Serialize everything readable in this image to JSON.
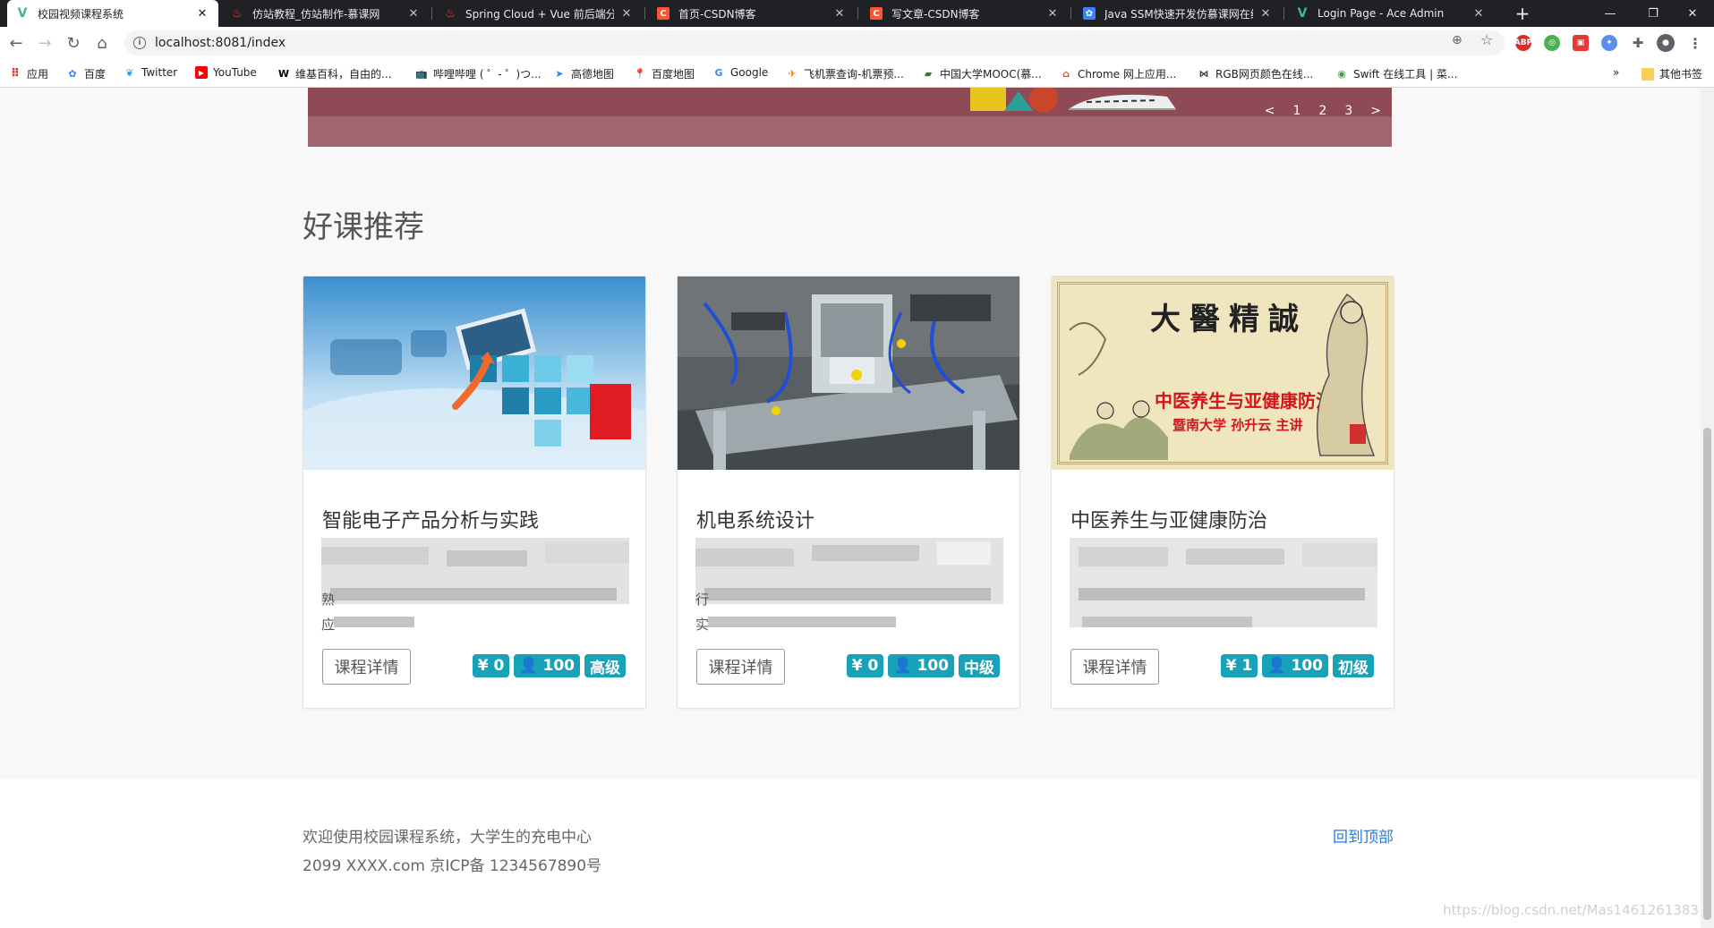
{
  "browser": {
    "tabs": [
      {
        "title": "校园视频课程系统",
        "favicon": "vue-logo-icon",
        "color": "#41b883",
        "active": true
      },
      {
        "title": "仿站教程_仿站制作-慕课网",
        "favicon": "flame-icon",
        "color": "#e8453c"
      },
      {
        "title": "Spring Cloud + Vue 前后端分离",
        "favicon": "flame-icon",
        "color": "#e8453c"
      },
      {
        "title": "首页-CSDN博客",
        "favicon": "csdn-icon",
        "color": "#fc5531"
      },
      {
        "title": "写文章-CSDN博客",
        "favicon": "csdn-icon",
        "color": "#fc5531"
      },
      {
        "title": "Java SSM快速开发仿慕课网在线",
        "favicon": "paw-icon",
        "color": "#3385ff"
      },
      {
        "title": "Login Page - Ace Admin",
        "favicon": "vue-logo-icon",
        "color": "#41b883"
      }
    ],
    "url": "localhost:8081/index",
    "bookmarks": [
      {
        "label": "应用",
        "icon": "apps-grid-icon"
      },
      {
        "label": "百度",
        "icon": "baidu-paw-icon"
      },
      {
        "label": "Twitter",
        "icon": "twitter-bird-icon"
      },
      {
        "label": "YouTube",
        "icon": "youtube-icon"
      },
      {
        "label": "维基百科，自由的...",
        "icon": "wikipedia-w-icon"
      },
      {
        "label": "哔哩哔哩 ( ゜- ゜)つ...",
        "icon": "bilibili-tv-icon"
      },
      {
        "label": "高德地图",
        "icon": "amap-icon"
      },
      {
        "label": "百度地图",
        "icon": "map-pin-icon"
      },
      {
        "label": "Google",
        "icon": "google-g-icon"
      },
      {
        "label": "飞机票查询-机票预...",
        "icon": "flight-icon"
      },
      {
        "label": "中国大学MOOC(慕...",
        "icon": "mooc-icon"
      },
      {
        "label": "Chrome 网上应用...",
        "icon": "chrome-store-icon"
      },
      {
        "label": "RGB网页颜色在线...",
        "icon": "rgb-icon"
      },
      {
        "label": "Swift 在线工具 | 菜...",
        "icon": "swift-icon"
      }
    ],
    "other_bookmarks": "其他书签",
    "overflow": "»"
  },
  "banner": {
    "pager": [
      "<",
      "1",
      "2",
      "3",
      ">"
    ]
  },
  "section": {
    "title": "好课推荐"
  },
  "courses": [
    {
      "title": "智能电子产品分析与实践",
      "detail_label": "课程详情",
      "price": "¥ 0",
      "enrolled": "100",
      "level": "高级",
      "snippet": [
        "熟",
        "应"
      ]
    },
    {
      "title": "机电系统设计",
      "detail_label": "课程详情",
      "price": "¥ 0",
      "enrolled": "100",
      "level": "中级",
      "snippet": [
        "行",
        "实"
      ]
    },
    {
      "title": "中医养生与亚健康防治",
      "detail_label": "课程详情",
      "price": "¥ 1",
      "enrolled": "100",
      "level": "初级",
      "image_text": {
        "heading": "大醫精誠",
        "subtitle": "中医养生与亚健康防治",
        "lecturer": "暨南大学  孙升云 主讲"
      }
    }
  ],
  "footer": {
    "welcome": "欢迎使用校园课程系统，大学生的充电中心",
    "copyright": "2099 XXXX.com 京ICP备 1234567890号",
    "back_to_top": "回到顶部"
  },
  "watermark": "https://blog.csdn.net/Mas1461261383",
  "colors": {
    "badge": "#17a2b8",
    "link": "#2a7bd8",
    "banner": "#8e4a55"
  }
}
